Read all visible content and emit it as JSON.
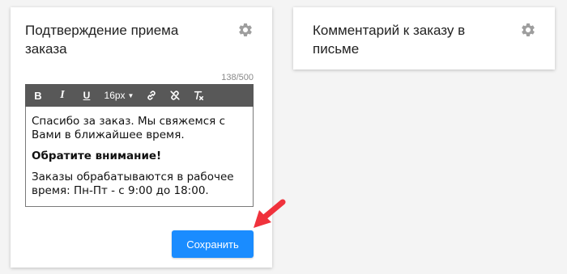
{
  "colors": {
    "background": "#f4f4f4",
    "card": "#ffffff",
    "toolbar": "#585858",
    "primary_button": "#1a8cff",
    "gear": "#9e9e9e",
    "annotation_arrow": "#f0323c"
  },
  "left_card": {
    "title": "Подтверждение приема заказа",
    "settings_icon": "gear-icon",
    "char_counter": "138/500",
    "toolbar": {
      "bold_label": "B",
      "italic_label": "I",
      "underline_label": "U",
      "font_size_value": "16px",
      "link_icon": "link-icon",
      "unlink_icon": "unlink-icon",
      "clear_format_icon": "clear-format-icon"
    },
    "editor": {
      "paragraph_1": "Спасибо за заказ. Мы свяжемся с Вами в ближайшее время.",
      "paragraph_2": "Обратите внимание!",
      "paragraph_3": "Заказы обрабатываются в рабочее время: Пн-Пт - с 9:00 до 18:00."
    },
    "save_label": "Сохранить"
  },
  "right_card": {
    "title": "Комментарий к заказу в письме",
    "settings_icon": "gear-icon"
  },
  "annotation": {
    "icon": "red-pointer-arrow"
  }
}
